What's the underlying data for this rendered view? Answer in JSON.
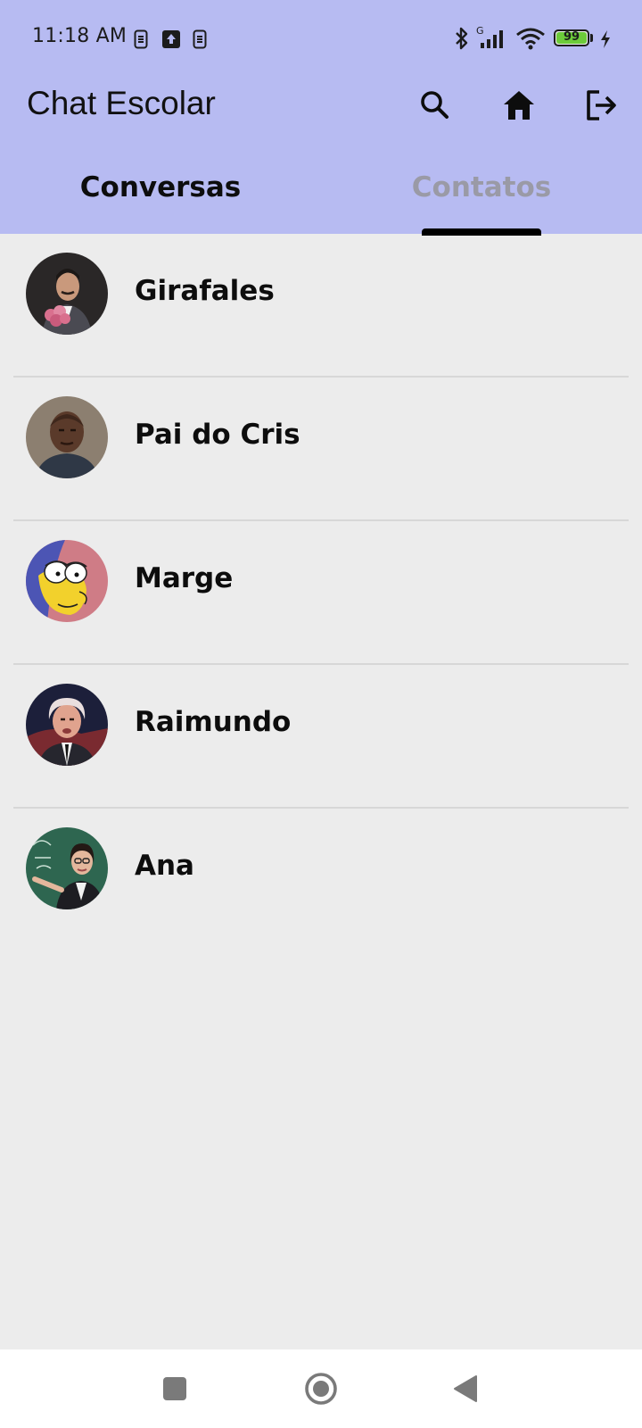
{
  "status_bar": {
    "time": "11:18 AM",
    "icons": [
      "sim-card-icon",
      "upload-notification-icon",
      "sim-card-icon",
      "bluetooth-icon",
      "cellular-signal-icon",
      "wifi-icon",
      "battery-icon",
      "charging-icon"
    ],
    "network_type": "G",
    "battery_level": 99,
    "battery_label": "99"
  },
  "app_bar": {
    "title": "Chat Escolar",
    "actions": [
      "search-icon",
      "home-icon",
      "logout-icon"
    ]
  },
  "tabs": [
    {
      "label": "Conversas",
      "active": false
    },
    {
      "label": "Contatos",
      "active": true
    }
  ],
  "colors": {
    "header_bg": "#b7bbf2",
    "body_bg": "#ececec",
    "tab_inactive": "#9a9aa6",
    "tab_indicator": "#000000",
    "battery_fill": "#6ccb3a"
  },
  "contacts": [
    {
      "name": "Girafales",
      "avatar": "girafales-avatar"
    },
    {
      "name": "Pai do Cris",
      "avatar": "pai-do-cris-avatar"
    },
    {
      "name": "Marge",
      "avatar": "marge-avatar"
    },
    {
      "name": "Raimundo",
      "avatar": "raimundo-avatar"
    },
    {
      "name": "Ana",
      "avatar": "ana-avatar"
    }
  ],
  "nav_bar": {
    "buttons": [
      "recents-button",
      "home-button",
      "back-button"
    ]
  }
}
